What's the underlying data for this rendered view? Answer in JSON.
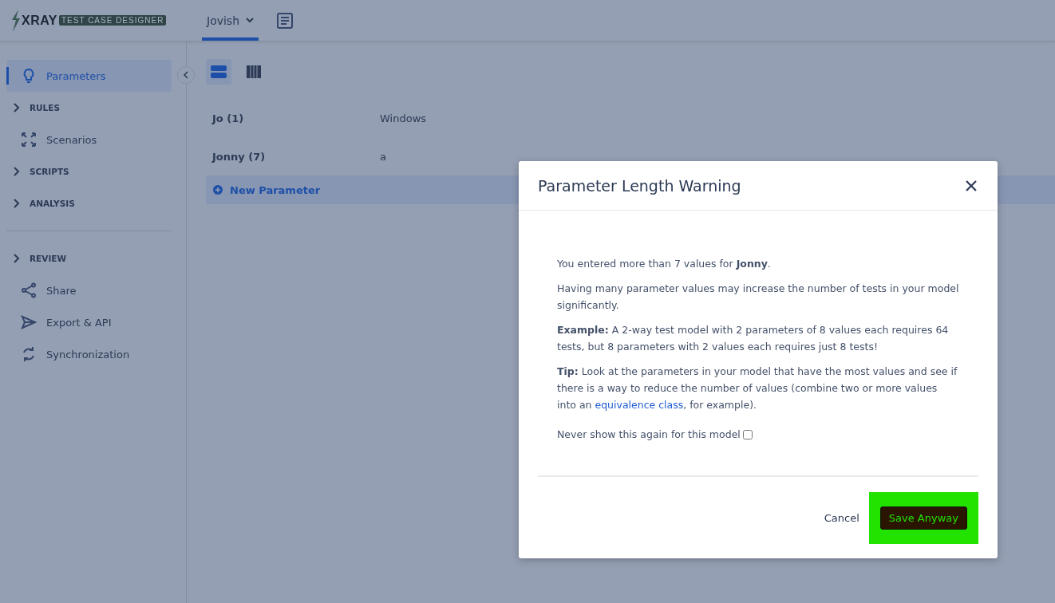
{
  "header": {
    "logo_word": "XRAY",
    "logo_badge": "TEST CASE DESIGNER",
    "tabs": [
      {
        "label": "Jovish",
        "selected": true
      }
    ]
  },
  "sidebar": {
    "items": [
      {
        "kind": "link",
        "label": "Parameters",
        "selected": true
      },
      {
        "kind": "section",
        "label": "RULES",
        "expanded": false
      },
      {
        "kind": "link",
        "label": "Scenarios",
        "selected": false
      },
      {
        "kind": "section",
        "label": "SCRIPTS",
        "expanded": false
      },
      {
        "kind": "section",
        "label": "ANALYSIS",
        "expanded": false
      },
      {
        "kind": "divider"
      },
      {
        "kind": "section",
        "label": "REVIEW",
        "expanded": false
      },
      {
        "kind": "link",
        "label": "Share",
        "selected": false
      },
      {
        "kind": "link",
        "label": "Export & API",
        "selected": false
      },
      {
        "kind": "link",
        "label": "Synchronization",
        "selected": false
      }
    ]
  },
  "view_toggle": [
    {
      "selected": true
    },
    {
      "selected": false
    }
  ],
  "parameters": [
    {
      "name": "Jo (1)",
      "values": [
        "Windows"
      ]
    },
    {
      "name": "Jonny (7)",
      "values": [
        "a"
      ]
    }
  ],
  "new_parameter": "New Parameter",
  "dialog": {
    "title": "Parameter Length Warning",
    "paragraphs": [
      "You entered more than 7 values for **Jonny**.",
      "Having many parameter values may increase the number of tests in your model significantly.",
      "**Example:** A 2-way test model with 2 parameters of 8 values each requires 64 tests, but 8 parameters with 2 values each requires just 8 tests!"
    ],
    "tip": {
      "before": "**Tip:** Look at the parameters in your model that have the most values and see if there is a way to reduce the number of values (combine two or more values into an",
      "link": "equivalence class",
      "after": ", for example)."
    },
    "checkbox": {
      "label": "Never show this again for this model",
      "checked": false
    },
    "cancel": "Cancel",
    "confirm": "Save Anyway",
    "confirm_highlighted": true
  }
}
